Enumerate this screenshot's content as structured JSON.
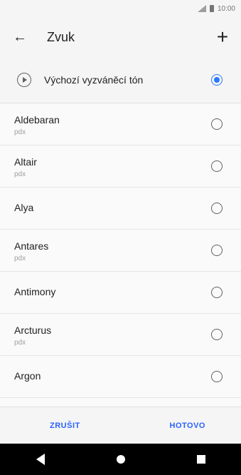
{
  "status": {
    "time": "10:00",
    "signal_icon": "signal-icon",
    "battery_icon": "battery-icon"
  },
  "appbar": {
    "back_icon": "arrow-back-icon",
    "title": "Zvuk",
    "add_icon": "plus-icon"
  },
  "default_ringtone": {
    "label": "Výchozí vyzváněcí tón",
    "selected": true
  },
  "ringtones": [
    {
      "name": "Aldebaran",
      "source": "pdx",
      "selected": false
    },
    {
      "name": "Altair",
      "source": "pdx",
      "selected": false
    },
    {
      "name": "Alya",
      "source": "",
      "selected": false
    },
    {
      "name": "Antares",
      "source": "pdx",
      "selected": false
    },
    {
      "name": "Antimony",
      "source": "",
      "selected": false
    },
    {
      "name": "Arcturus",
      "source": "pdx",
      "selected": false
    },
    {
      "name": "Argon",
      "source": "",
      "selected": false
    }
  ],
  "actions": {
    "cancel": "ZRUŠIT",
    "done": "HOTOVO"
  },
  "colors": {
    "accent": "#2979ff",
    "action_text": "#2962ff",
    "navbar": "#000000"
  }
}
